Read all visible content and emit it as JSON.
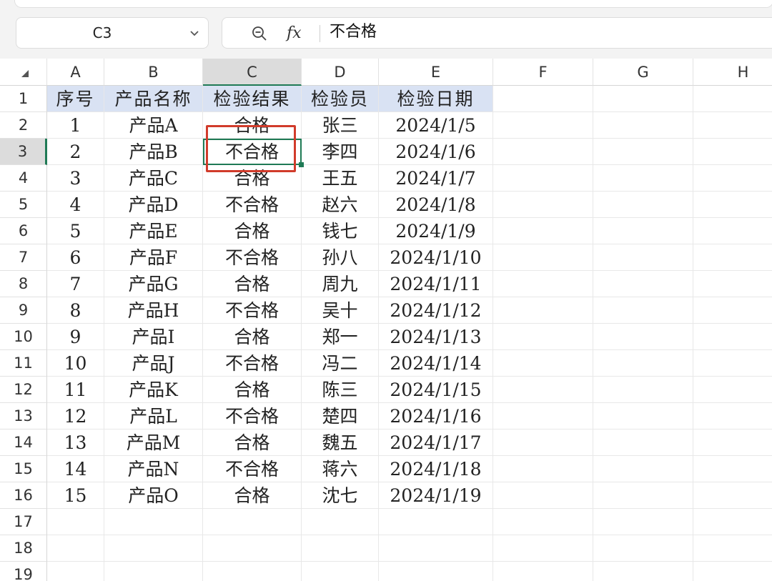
{
  "name_box": {
    "value": "C3"
  },
  "formula_bar": {
    "fx_label": "fx",
    "value": "不合格"
  },
  "columns": [
    "A",
    "B",
    "C",
    "D",
    "E",
    "F",
    "G",
    "H"
  ],
  "rows": [
    "1",
    "2",
    "3",
    "4",
    "5",
    "6",
    "7",
    "8",
    "9",
    "10",
    "11",
    "12",
    "13",
    "14",
    "15",
    "16",
    "17",
    "18",
    "19"
  ],
  "selected_cell": "C3",
  "header_fill": "#d9e2f3",
  "selection_color": "#1f7a55",
  "annotation_color": "#d13b2b",
  "table": {
    "headers": [
      "序号",
      "产品名称",
      "检验结果",
      "检验员",
      "检验日期"
    ],
    "rows": [
      [
        "1",
        "产品A",
        "合格",
        "张三",
        "2024/1/5"
      ],
      [
        "2",
        "产品B",
        "不合格",
        "李四",
        "2024/1/6"
      ],
      [
        "3",
        "产品C",
        "合格",
        "王五",
        "2024/1/7"
      ],
      [
        "4",
        "产品D",
        "不合格",
        "赵六",
        "2024/1/8"
      ],
      [
        "5",
        "产品E",
        "合格",
        "钱七",
        "2024/1/9"
      ],
      [
        "6",
        "产品F",
        "不合格",
        "孙八",
        "2024/1/10"
      ],
      [
        "7",
        "产品G",
        "合格",
        "周九",
        "2024/1/11"
      ],
      [
        "8",
        "产品H",
        "不合格",
        "吴十",
        "2024/1/12"
      ],
      [
        "9",
        "产品I",
        "合格",
        "郑一",
        "2024/1/13"
      ],
      [
        "10",
        "产品J",
        "不合格",
        "冯二",
        "2024/1/14"
      ],
      [
        "11",
        "产品K",
        "合格",
        "陈三",
        "2024/1/15"
      ],
      [
        "12",
        "产品L",
        "不合格",
        "楚四",
        "2024/1/16"
      ],
      [
        "13",
        "产品M",
        "合格",
        "魏五",
        "2024/1/17"
      ],
      [
        "14",
        "产品N",
        "不合格",
        "蒋六",
        "2024/1/18"
      ],
      [
        "15",
        "产品O",
        "合格",
        "沈七",
        "2024/1/19"
      ]
    ]
  }
}
